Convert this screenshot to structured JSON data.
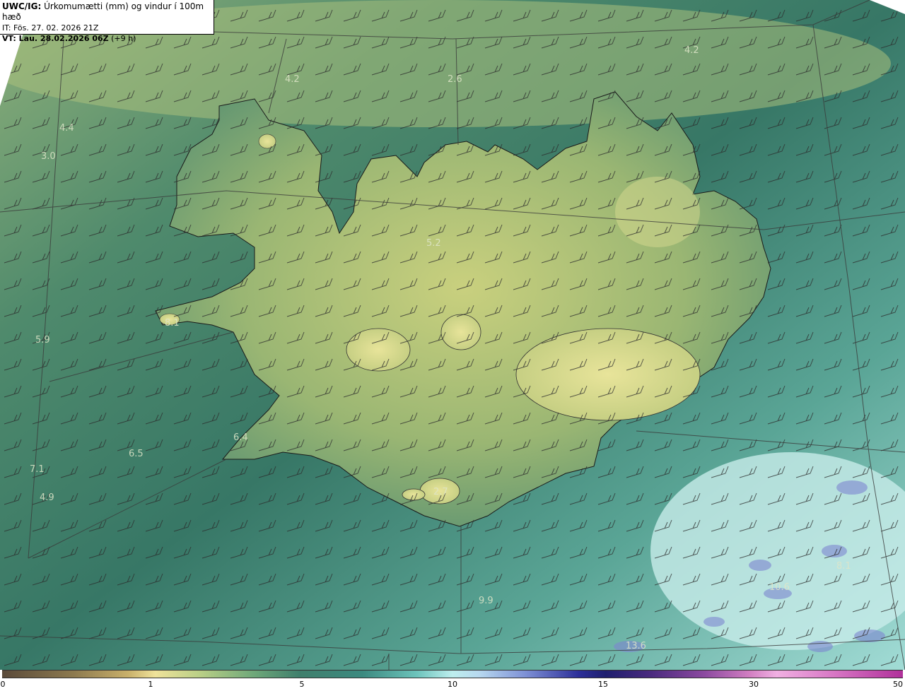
{
  "header": {
    "model": "UWC/IG:",
    "description": "Úrkomumætti (mm) og vindur í 100m hæð",
    "init_time": "IT: Fös. 27. 02. 2026 21Z",
    "valid_prefix": "VT: Lau. 28.02.2026 06Z",
    "valid_suffix": "(+9 h)"
  },
  "colors": {
    "background_dark_green": "#2f6e5f",
    "land_yellow": "#d9dc8c",
    "ocean_cyan": "#a6e0dc",
    "heavy_blue": "#5662b8"
  },
  "field_values": [
    {
      "text": "4.2"
    },
    {
      "text": "2.6"
    },
    {
      "text": "4.2"
    },
    {
      "text": "4.4"
    },
    {
      "text": "3.0"
    },
    {
      "text": "5.2"
    },
    {
      "text": "5.9"
    },
    {
      "text": "6.4"
    },
    {
      "text": "6.5"
    },
    {
      "text": "7.1"
    },
    {
      "text": "4.9"
    },
    {
      "text": "8.1"
    },
    {
      "text": "2.7"
    },
    {
      "text": "9.9"
    },
    {
      "text": "8.1"
    },
    {
      "text": "10.6"
    },
    {
      "text": "13.6"
    }
  ],
  "colorbar": {
    "ticks": [
      "0",
      "1",
      "5",
      "10",
      "15",
      "30",
      "50"
    ]
  }
}
